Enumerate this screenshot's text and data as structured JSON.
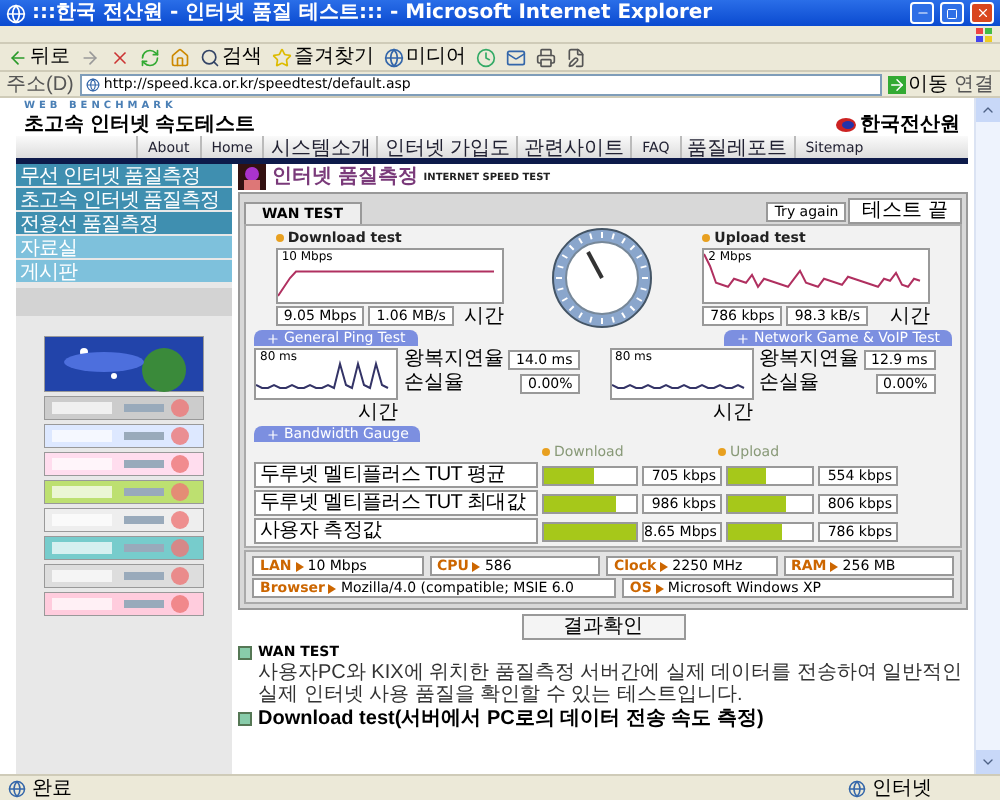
{
  "window": {
    "title": ":::한국 전산원 - 인터넷 품질 테스트::: - Microsoft Internet Explorer"
  },
  "toolbar": [
    {
      "kind": "back",
      "label": "뒤로"
    },
    {
      "kind": "forward"
    },
    {
      "kind": "stop"
    },
    {
      "kind": "refresh"
    },
    {
      "kind": "home"
    },
    {
      "kind": "search",
      "label": "검색"
    },
    {
      "kind": "favorites",
      "label": "즐겨찾기"
    },
    {
      "kind": "media",
      "label": "미디어"
    },
    {
      "kind": "history"
    },
    {
      "kind": "mail"
    },
    {
      "kind": "print"
    },
    {
      "kind": "edit"
    }
  ],
  "address_bar": {
    "label": "주소(D)",
    "value": "http://speed.kca.or.kr/speedtest/default.asp",
    "go": "이동",
    "links": "연결"
  },
  "site": {
    "tagline": "WEB BENCHMARK",
    "title": "초고속 인터넷 속도테스트",
    "org": "한국전산원"
  },
  "nav": [
    "About",
    "Home",
    "시스템소개",
    "인터넷 가입도",
    "관련사이트",
    "FAQ",
    "품질레포트",
    "Sitemap"
  ],
  "sidebar": {
    "items": [
      "무선 인터넷 품질측정",
      "초고속 인터넷 품질측정",
      "전용선 품질측정",
      "자료실",
      "게시판"
    ],
    "banners": [
      {
        "kind": "picture"
      },
      {
        "kind": "picture"
      },
      {
        "kind": "picture"
      },
      {
        "kind": "picture"
      },
      {
        "kind": "picture"
      },
      {
        "kind": "picture"
      },
      {
        "kind": "picture"
      },
      {
        "kind": "picture"
      },
      {
        "kind": "picture"
      }
    ]
  },
  "test": {
    "heading": "인터넷 품질측정",
    "subheading": "INTERNET SPEED TEST",
    "tab": "WAN TEST",
    "try_again": "Try again",
    "status": "테스트 끝",
    "download": {
      "title": "Download test",
      "scale": "10 Mbps",
      "time": "시간",
      "rate": "9.05 Mbps",
      "bytes": "1.06 MB/s"
    },
    "upload": {
      "title": "Upload test",
      "scale": "2 Mbps",
      "time": "시간",
      "rate": "786 kbps",
      "bytes": "98.3 kB/s"
    },
    "ping_tabs": [
      "General Ping Test",
      "Network Game & VoIP Test"
    ],
    "pings": [
      {
        "scale": "80 ms",
        "delay_label": "왕복지연율",
        "delay": "14.0 ms",
        "loss_label": "손실율",
        "loss": "0.00%",
        "time": "시간"
      },
      {
        "scale": "80 ms",
        "delay_label": "왕복지연율",
        "delay": "12.9 ms",
        "loss_label": "손실율",
        "loss": "0.00%",
        "time": "시간"
      }
    ],
    "bandwidth": {
      "tab": "Bandwidth Gauge",
      "download_label": "Download",
      "upload_label": "Upload",
      "rows": [
        {
          "name": "두루넷 멜티플러스 TUT 평균",
          "download": {
            "level": 0.55,
            "reading": "705 kbps"
          },
          "upload": {
            "level": 0.45,
            "reading": "554 kbps"
          }
        },
        {
          "name": "두루넷 멜티플러스 TUT 최대값",
          "download": {
            "level": 0.78,
            "reading": "986 kbps"
          },
          "upload": {
            "level": 0.7,
            "reading": "806 kbps"
          }
        },
        {
          "name": "사용자 측정값",
          "download": {
            "level": 1.0,
            "reading": "8.65 Mbps"
          },
          "upload": {
            "level": 0.65,
            "reading": "786 kbps"
          }
        }
      ]
    },
    "system": [
      {
        "label": "LAN",
        "value": "10 Mbps"
      },
      {
        "label": "CPU",
        "value": "586"
      },
      {
        "label": "Clock",
        "value": "2250 MHz"
      },
      {
        "label": "RAM",
        "value": "256 MB"
      },
      {
        "label": "Browser",
        "value": "Mozilla/4.0 (compatible; MSIE 6.0"
      },
      {
        "label": "OS",
        "value": "Microsoft Windows XP"
      }
    ],
    "result_button": "결과확인"
  },
  "notes": [
    {
      "title": "WAN TEST",
      "body": "사용자PC와 KIX에 위치한 품질측정 서버간에 실제 데이터를 전송하여 일반적인 실제 인터넷 사용 품질을 확인할 수 있는 테스트입니다."
    },
    {
      "title": "Download test(서버에서 PC로의 데이터 전송 속도 측정)"
    }
  ],
  "status_bar": {
    "text": "완료",
    "zone": "인터넷"
  }
}
